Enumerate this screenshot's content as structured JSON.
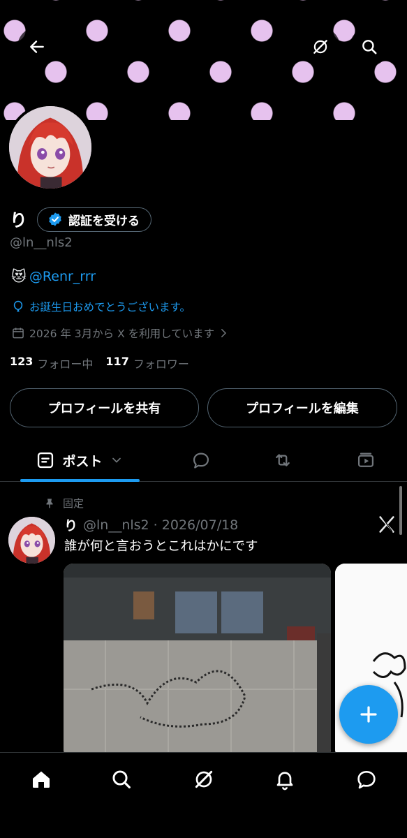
{
  "header": {
    "back_icon": "arrow-left-icon",
    "grok_icon": "grok-icon",
    "search_icon": "search-icon"
  },
  "profile": {
    "display_name": "り",
    "verify_label": "認証を受ける",
    "handle": "@ln__nls2",
    "bio_emoji": "😻",
    "bio_mention": "@Renr_rrr",
    "birthday_text": "お誕生日おめでとうございます。",
    "joined_text": "2026 年 3月から X を利用しています",
    "following_count": "123",
    "following_label": "フォロー中",
    "followers_count": "117",
    "followers_label": "フォロワー",
    "share_button": "プロフィールを共有",
    "edit_button": "プロフィールを編集"
  },
  "tabs": {
    "active_label": "ポスト",
    "items": [
      "posts",
      "replies",
      "reposts",
      "videos"
    ]
  },
  "post": {
    "pinned_label": "固定",
    "author_name": "り",
    "author_meta": "@ln__nls2 · 2026/07/18",
    "text": "誰が何と言おうとこれはかにです"
  },
  "nav": {
    "items": [
      "home-icon",
      "search-icon",
      "grok-icon",
      "bell-icon",
      "messages-icon"
    ]
  },
  "colors": {
    "accent": "#1d9bf0",
    "banner_dot": "#e6c2ee",
    "muted": "#71767b",
    "border": "#536471"
  }
}
